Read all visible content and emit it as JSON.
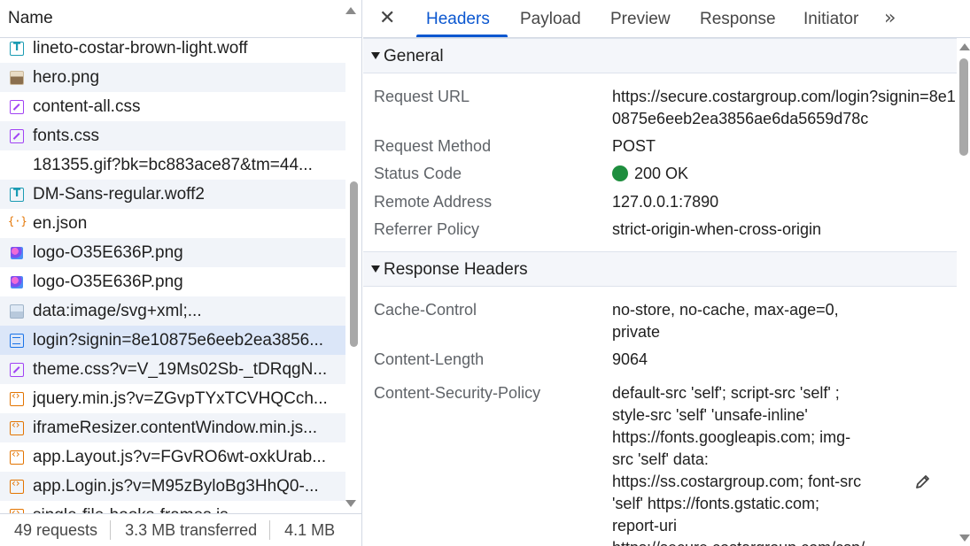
{
  "request_list": {
    "column_header": "Name",
    "files": [
      {
        "name": "lineto-costar-brown-light.woff",
        "icon": "font-file-icon"
      },
      {
        "name": "hero.png",
        "icon": "image-file-icon"
      },
      {
        "name": "content-all.css",
        "icon": "css-file-icon"
      },
      {
        "name": "fonts.css",
        "icon": "css-file-icon"
      },
      {
        "name": "181355.gif?bk=bc883ace87&tm=44...",
        "icon": "none"
      },
      {
        "name": "DM-Sans-regular.woff2",
        "icon": "font-file-icon"
      },
      {
        "name": "en.json",
        "icon": "json-file-icon"
      },
      {
        "name": "logo-O35E636P.png",
        "icon": "logo-image-icon"
      },
      {
        "name": "logo-O35E636P.png",
        "icon": "logo-image-icon"
      },
      {
        "name": "data:image/svg+xml;...",
        "icon": "svg-image-icon"
      },
      {
        "name": "login?signin=8e10875e6eeb2ea3856...",
        "icon": "document-file-icon",
        "selected": true
      },
      {
        "name": "theme.css?v=V_19Ms02Sb-_tDRqgN...",
        "icon": "css-file-icon"
      },
      {
        "name": "jquery.min.js?v=ZGvpTYxTCVHQCch...",
        "icon": "script-file-icon"
      },
      {
        "name": "iframeResizer.contentWindow.min.js...",
        "icon": "script-file-icon"
      },
      {
        "name": "app.Layout.js?v=FGvRO6wt-oxkUrab...",
        "icon": "script-file-icon"
      },
      {
        "name": "app.Login.js?v=M95zByloBg3HhQ0-...",
        "icon": "script-file-icon"
      },
      {
        "name": "single-file-hooks-frames.js",
        "icon": "script-file-icon"
      }
    ]
  },
  "status_bar": {
    "requests": "49 requests",
    "transferred": "3.3 MB transferred",
    "resources": "4.1 MB"
  },
  "tabs": {
    "close": "✕",
    "items": [
      "Headers",
      "Payload",
      "Preview",
      "Response",
      "Initiator"
    ],
    "active": "Headers",
    "more": "»"
  },
  "general": {
    "title": "General",
    "request_url_label": "Request URL",
    "request_url": "https://secure.costargroup.com/login?signin=8e10875e6eeb2ea3856ae6da5659d78c",
    "request_method_label": "Request Method",
    "request_method": "POST",
    "status_code_label": "Status Code",
    "status_code": "200 OK",
    "status_color": "#1e8e3e",
    "remote_address_label": "Remote Address",
    "remote_address": "127.0.0.1:7890",
    "referrer_policy_label": "Referrer Policy",
    "referrer_policy": "strict-origin-when-cross-origin"
  },
  "response_headers": {
    "title": "Response Headers",
    "cache_control_label": "Cache-Control",
    "cache_control": "no-store, no-cache, max-age=0, private",
    "content_length_label": "Content-Length",
    "content_length": "9064",
    "csp_label": "Content-Security-Policy",
    "csp_lines": [
      "default-src 'self'; script-src 'self' ;",
      "style-src 'self' 'unsafe-inline'",
      "https://fonts.googleapis.com; img-",
      "src 'self' data:",
      "https://ss.costargroup.com; font-src",
      "'self' https://fonts.gstatic.com;",
      "report-uri",
      "https://secure.costargroup.com/csp/"
    ]
  },
  "colors": {
    "accent": "#0b57d0",
    "selected_row": "#dbe6f8"
  }
}
